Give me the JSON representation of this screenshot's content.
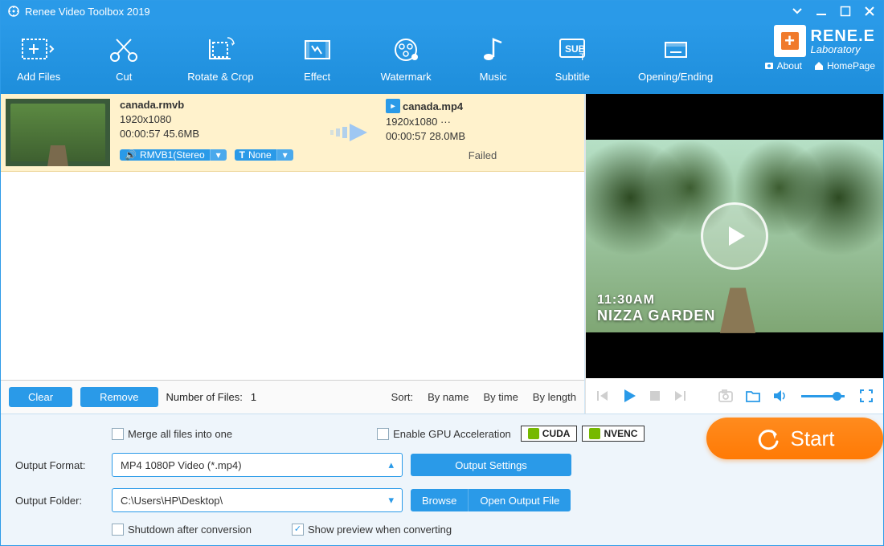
{
  "title": "Renee Video Toolbox 2019",
  "brand": {
    "line1": "RENE.E",
    "line2": "Laboratory",
    "about": "About",
    "homepage": "HomePage"
  },
  "toolbar": {
    "add": "Add Files",
    "cut": "Cut",
    "rotate": "Rotate & Crop",
    "effect": "Effect",
    "watermark": "Watermark",
    "music": "Music",
    "subtitle": "Subtitle",
    "opening": "Opening/Ending"
  },
  "file": {
    "src_name": "canada.rmvb",
    "src_res": "1920x1080",
    "src_line2": "00:00:57 45.6MB",
    "audio_tag": "RMVB1(Stereo",
    "sub_tag": "None",
    "dst_name": "canada.mp4",
    "dst_res": "1920x1080   ···",
    "dst_line2": "00:00:57 28.0MB",
    "status": "Failed"
  },
  "filebar": {
    "clear": "Clear",
    "remove": "Remove",
    "count_label": "Number of Files:",
    "count": "1",
    "sort": "Sort:",
    "byname": "By name",
    "bytime": "By time",
    "bylen": "By length"
  },
  "preview": {
    "time": "11:30AM",
    "place": "NIZZA GARDEN"
  },
  "bottom": {
    "merge": "Merge all files into one",
    "gpu": "Enable GPU Acceleration",
    "cuda": "CUDA",
    "nvenc": "NVENC",
    "fmt_label": "Output Format:",
    "fmt_value": "MP4 1080P Video (*.mp4)",
    "fld_label": "Output Folder:",
    "fld_value": "C:\\Users\\HP\\Desktop\\",
    "out_settings": "Output Settings",
    "browse": "Browse",
    "open_out": "Open Output File",
    "shutdown": "Shutdown after conversion",
    "showprev": "Show preview when converting",
    "start": "Start"
  }
}
